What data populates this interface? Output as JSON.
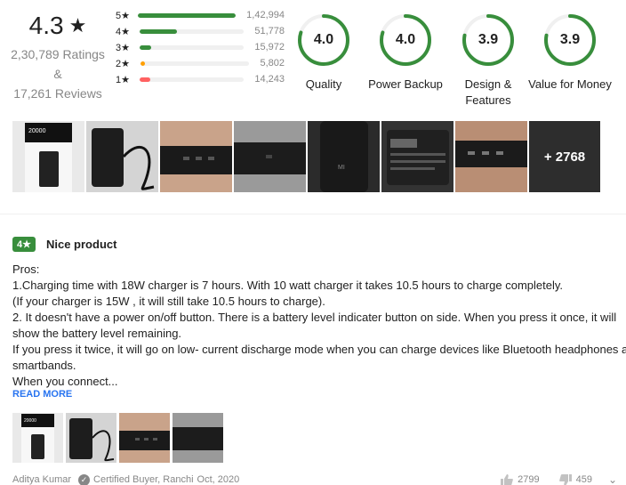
{
  "summary": {
    "average": "4.3",
    "star": "★",
    "ratings_text": "2,30,789 Ratings",
    "amp": "&",
    "reviews_text": "17,261 Reviews"
  },
  "histogram": [
    {
      "label": "5★",
      "count": "1,42,994",
      "fraction": 1.0,
      "color": "#388e3c"
    },
    {
      "label": "4★",
      "count": "51,778",
      "fraction": 0.36,
      "color": "#388e3c"
    },
    {
      "label": "3★",
      "count": "15,972",
      "fraction": 0.11,
      "color": "#388e3c"
    },
    {
      "label": "2★",
      "count": "5,802",
      "fraction": 0.04,
      "color": "#ff9f00"
    },
    {
      "label": "1★",
      "count": "14,243",
      "fraction": 0.1,
      "color": "#ff6161"
    }
  ],
  "features": [
    {
      "value": "4.0",
      "name": "Quality",
      "fraction": 0.8
    },
    {
      "value": "4.0",
      "name": "Power Backup",
      "fraction": 0.8
    },
    {
      "value": "3.9",
      "name": "Design & Features",
      "fraction": 0.78
    },
    {
      "value": "3.9",
      "name": "Value for Money",
      "fraction": 0.78
    }
  ],
  "gallery": {
    "more_label": "+ 2768"
  },
  "review": {
    "rating": "4★",
    "title": "Nice product",
    "lines": [
      "Pros:",
      "1.Charging time with 18W charger is 7 hours. With 10 watt charger it takes 10.5 hours to charge completely.",
      "(If your charger is 15W , it will still take 10.5 hours to charge).",
      "2. It doesn't have a power on/off button. There is a battery level indicater button on side. When you press it once, it will",
      "show the battery level remaining.",
      "If you press it twice, it will go on low- current discharge mode when you can charge devices like Bluetooth headphones and",
      "smartbands.",
      "When you connect..."
    ],
    "read_more": "READ MORE",
    "author": "Aditya Kumar",
    "certified": "Certified Buyer, Ranchi",
    "date": "Oct, 2020",
    "likes": "2799",
    "dislikes": "459"
  },
  "colors": {
    "accent_green": "#388e3c",
    "link_blue": "#2874f0",
    "muted": "#878787"
  }
}
